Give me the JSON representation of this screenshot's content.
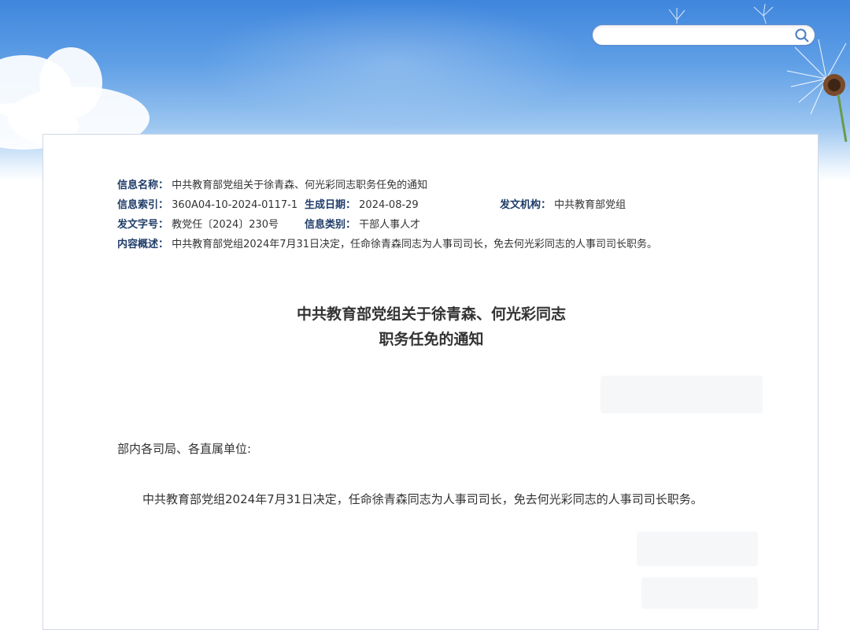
{
  "header": {
    "search": {
      "placeholder": "",
      "value": ""
    }
  },
  "meta": {
    "name_label": "信息名称：",
    "name_value": "中共教育部党组关于徐青森、何光彩同志职务任免的通知",
    "index_label": "信息索引：",
    "index_value": "360A04-10-2024-0117-1",
    "date_label": "生成日期：",
    "date_value": "2024-08-29",
    "issuer_label": "发文机构：",
    "issuer_value": "中共教育部党组",
    "docno_label": "发文字号：",
    "docno_value": "教党任〔2024〕230号",
    "category_label": "信息类别：",
    "category_value": "干部人事人才",
    "summary_label": "内容概述：",
    "summary_value": "中共教育部党组2024年7月31日决定，任命徐青森同志为人事司司长，免去何光彩同志的人事司司长职务。"
  },
  "article": {
    "title_line1": "中共教育部党组关于徐青森、何光彩同志",
    "title_line2": "职务任免的通知",
    "salutation": "部内各司局、各直属单位:",
    "paragraph": "中共教育部党组2024年7月31日决定，任命徐青森同志为人事司司长，免去何光彩同志的人事司司长职务。"
  }
}
